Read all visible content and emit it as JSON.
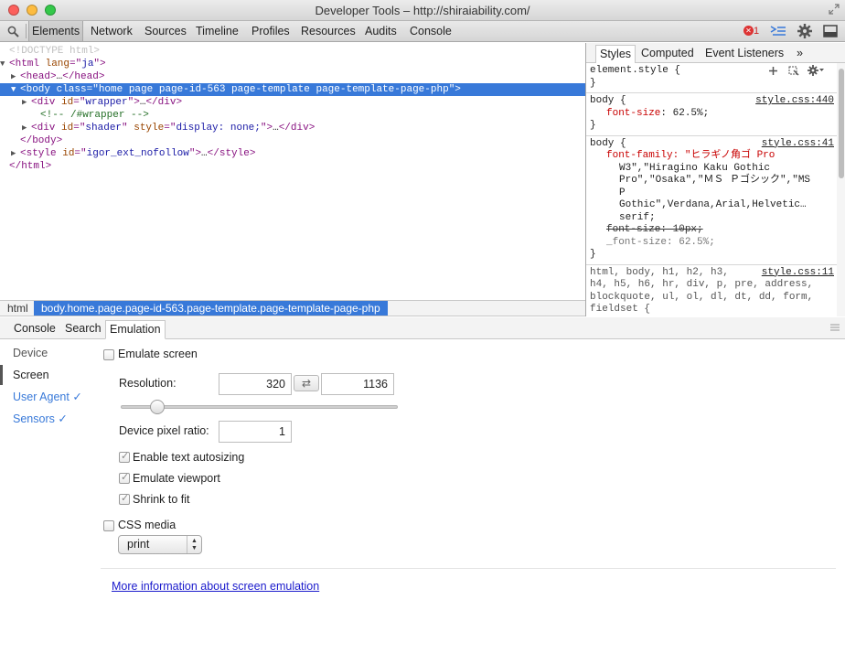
{
  "window": {
    "title": "Developer Tools – http://shiraiability.com/",
    "traffic_lights": {
      "close": "#fc605c",
      "minimize": "#fdbc40",
      "zoom": "#34c84a"
    }
  },
  "toolbar": {
    "tabs": [
      "Elements",
      "Network",
      "Sources",
      "Timeline",
      "Profiles",
      "Resources",
      "Audits",
      "Console"
    ],
    "active_tab": "Elements",
    "error_count": "1",
    "icons": [
      "search-icon",
      "error-icon",
      "console-drawer-icon",
      "settings-gear-icon",
      "dock-icon"
    ]
  },
  "elements_tree": {
    "doctype": "<!DOCTYPE html>",
    "html_lang": "ja",
    "head_text": "…",
    "body_class": "home page page-id-563 page-template page-template-page-php",
    "wrapper_id": "wrapper",
    "comment": "<!-- /#wrapper -->",
    "shader_id": "shader",
    "shader_style": "display: none;",
    "style_id": "igor_ext_nofollow",
    "ellipsis": "…"
  },
  "breadcrumb": {
    "items": [
      "html",
      "body.home.page.page-id-563.page-template.page-template-page-php"
    ]
  },
  "sidebar": {
    "tabs": [
      "Styles",
      "Computed",
      "Event Listeners"
    ],
    "more_label": "»",
    "active_tab": "Styles",
    "rules": [
      {
        "selector": "element.style {",
        "close": "}",
        "source": ""
      },
      {
        "selector": "body {",
        "source": "style.css:440",
        "prop": "font-size",
        "value": "62.5%;",
        "close": "}"
      },
      {
        "selector": "body {",
        "source": "style.css:41",
        "font_family_lines": [
          "font-family: \"ヒラギノ角ゴ Pro",
          "W3\",\"Hiragino Kaku Gothic",
          "Pro\",\"Osaka\",\"ＭＳ Ｐゴシック\",\"MS",
          "P",
          "Gothic\",Verdana,Arial,Helvetic…",
          "serif;"
        ],
        "overridden": "font-size: 10px;",
        "underscore_prop": "_font-size: 62.5%;",
        "close": "}"
      },
      {
        "selector_lines": [
          "html, body, h1, h2, h3,",
          "h4, h5, h6, hr, div, p, pre, address,",
          "blockquote, ul, ol, dl, dt, dd, form,",
          "fieldset {"
        ],
        "source": "style.css:11"
      }
    ]
  },
  "drawer": {
    "tabs": [
      "Console",
      "Search",
      "Emulation"
    ],
    "active_tab": "Emulation"
  },
  "emulation": {
    "nav": [
      {
        "label": "Device"
      },
      {
        "label": "Screen"
      },
      {
        "label": "User Agent ✓"
      },
      {
        "label": "Sensors ✓"
      }
    ],
    "active_nav": "Screen",
    "emulate_screen_label": "Emulate screen",
    "emulate_screen_checked": false,
    "resolution_label": "Resolution:",
    "resolution_width": "320",
    "resolution_height": "1136",
    "swap_icon": "⇄",
    "dpr_label": "Device pixel ratio:",
    "dpr_value": "1",
    "options": [
      {
        "label": "Enable text autosizing",
        "checked": true
      },
      {
        "label": "Emulate viewport",
        "checked": true
      },
      {
        "label": "Shrink to fit",
        "checked": true
      }
    ],
    "css_media_label": "CSS media",
    "css_media_checked": false,
    "css_media_selected": "print",
    "more_info_link": "More information about screen emulation"
  }
}
